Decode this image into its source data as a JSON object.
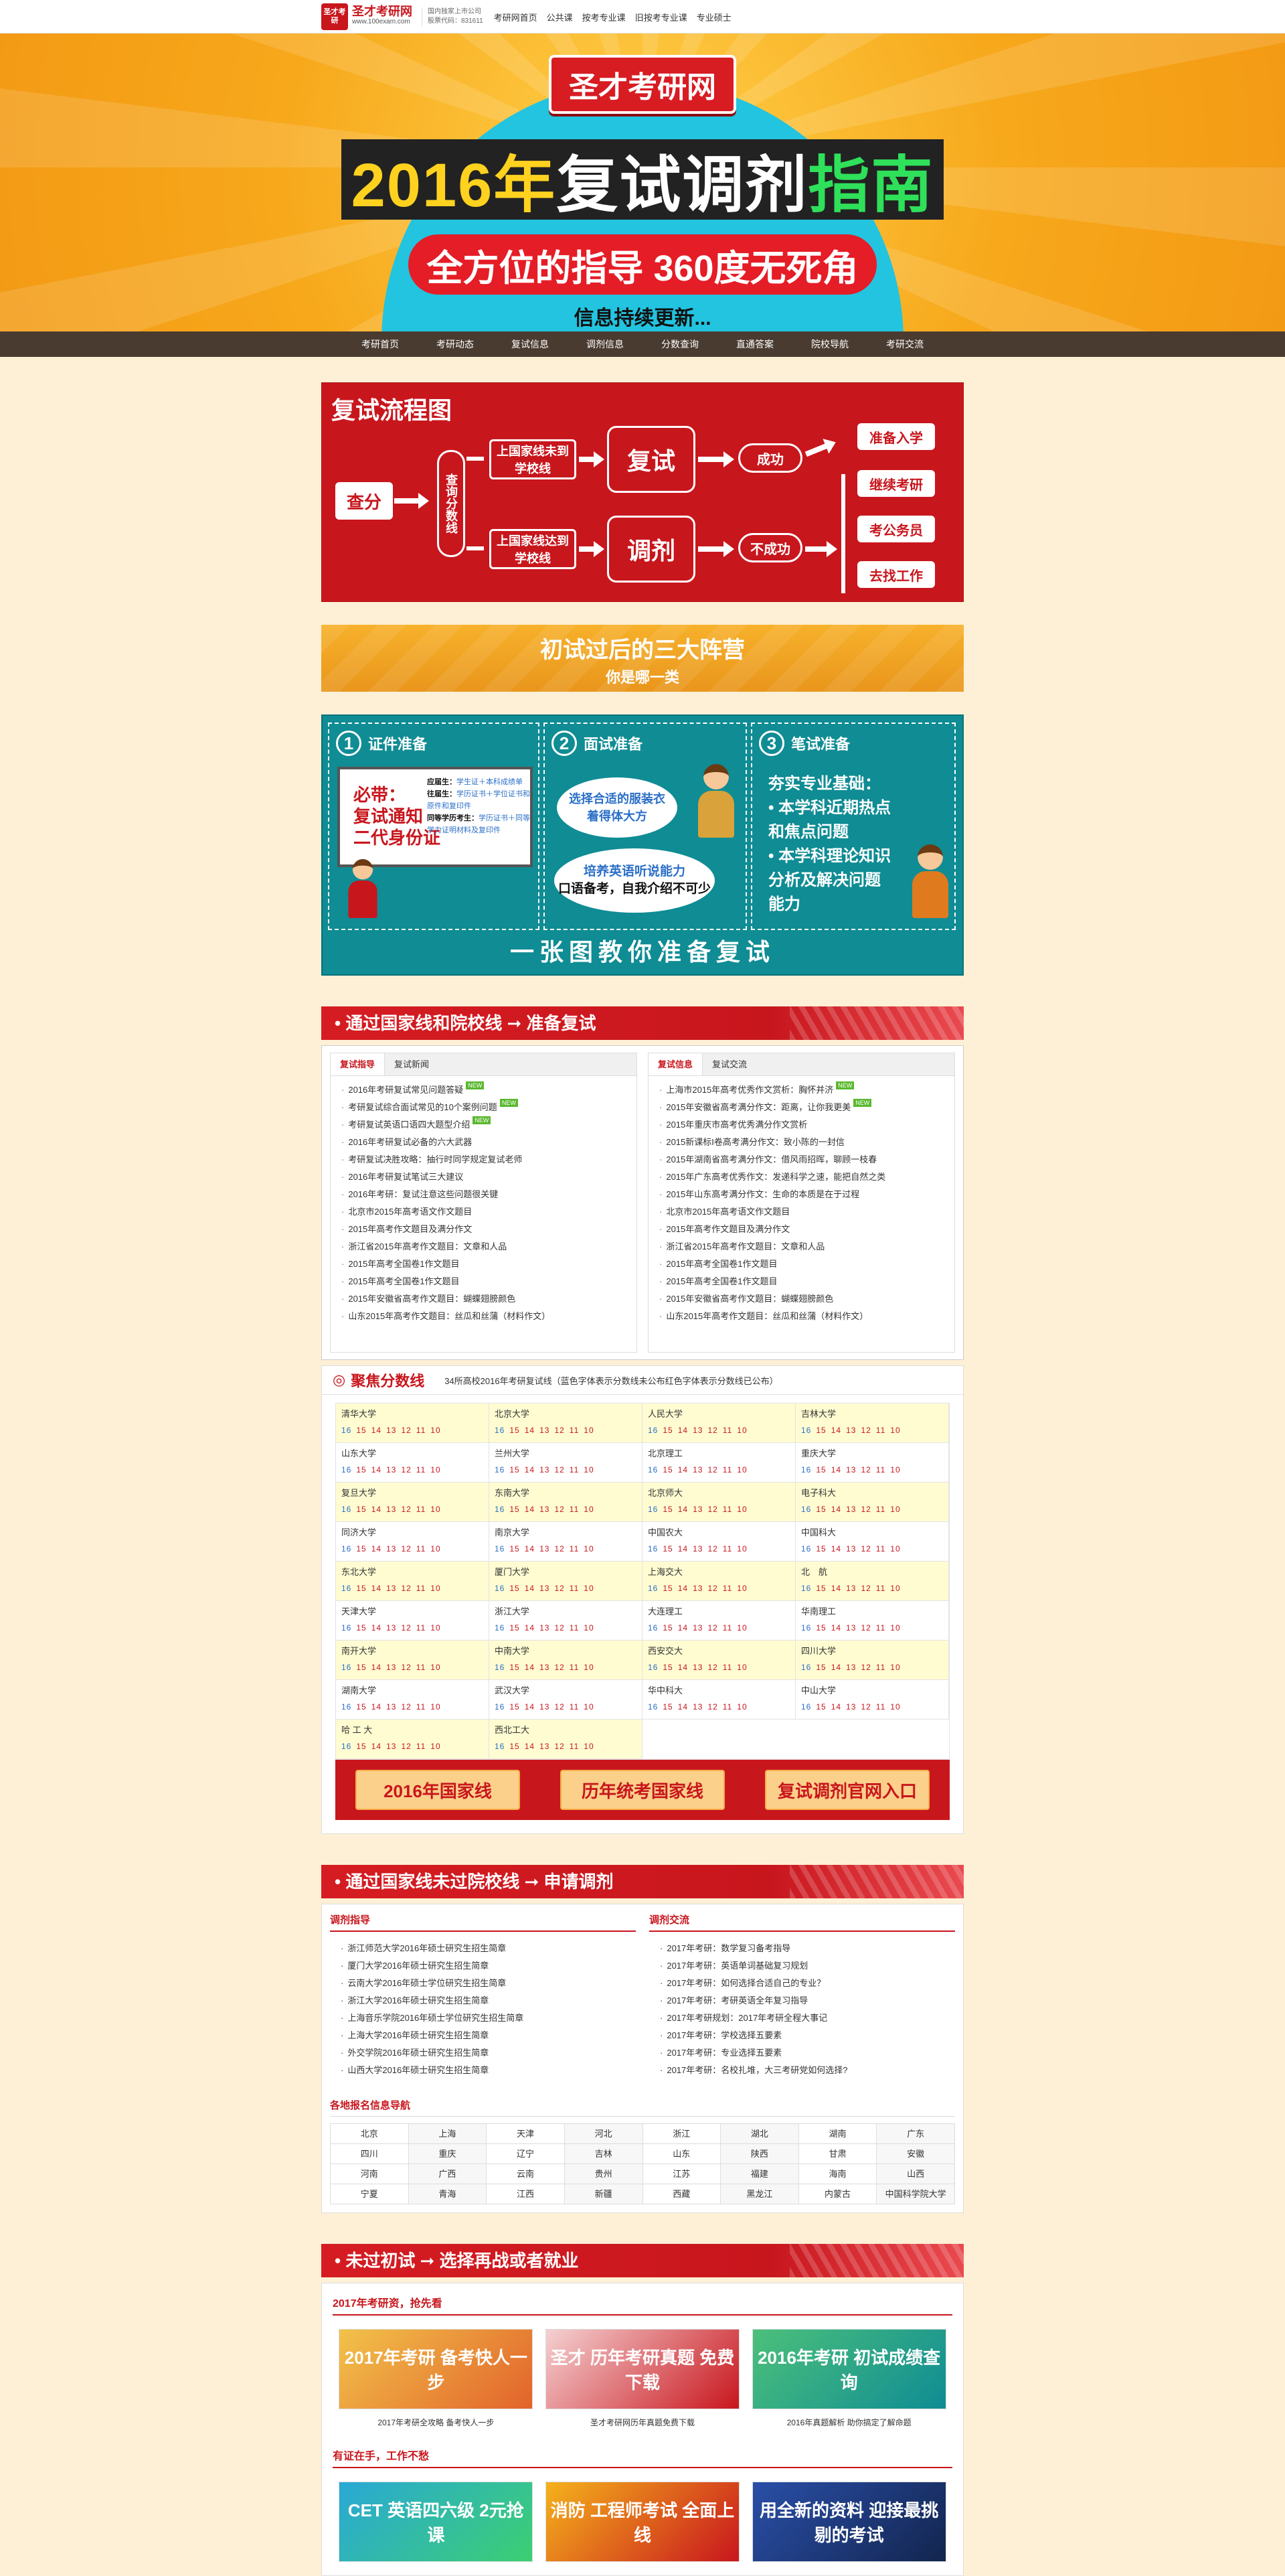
{
  "topbar": {
    "logo_mark": "圣才考研",
    "site_name": "圣才考研网",
    "site_url": "www.100exam.com",
    "company_line1": "国内独家上市公司",
    "company_line2": "股票代码：831611",
    "nav": [
      "考研网首页",
      "公共课",
      "按考专业课",
      "旧按考专业课",
      "专业硕士"
    ]
  },
  "banner": {
    "logo": "圣才考研网",
    "title_year": "2016年",
    "title_mid": "复试调剂",
    "title_end": "指南",
    "subtitle": "全方位的指导 360度无死角",
    "more": "信息持续更新..."
  },
  "mainnav": [
    "考研首页",
    "考研动态",
    "复试信息",
    "调剂信息",
    "分数查询",
    "直通答案",
    "院校导航",
    "考研交流"
  ],
  "flow": {
    "title": "复试流程图",
    "check": "查分",
    "query": "查询分数线",
    "over_nat": "上国家线未到学校线",
    "over_school": "上国家线达到学校线",
    "retest": "复试",
    "adjust": "调剂",
    "success": "成功",
    "fail": "不成功",
    "outcomes": [
      "准备入学",
      "继续考研",
      "考公务员",
      "去找工作"
    ]
  },
  "camp": {
    "title": "初试过后的三大阵营",
    "sub": "你是哪一类"
  },
  "prep": {
    "c1": {
      "num": "1",
      "title": "证件准备",
      "must": [
        "必带：",
        "复试通知",
        "二代身份证"
      ],
      "items": [
        {
          "k": "应届生：",
          "v": "学生证＋本科成绩单"
        },
        {
          "k": "往届生：",
          "v": "学历证书＋学位证书和原件和复印件"
        },
        {
          "k": "同等学历考生：",
          "v": "学历证书＋同等学力证明材料及复印件"
        }
      ]
    },
    "c2": {
      "num": "2",
      "title": "面试准备",
      "b1": "选择合适的服装衣着得体大方",
      "b2a": "培养英语听说能力",
      "b2b": "口语备考，自我介绍不可少"
    },
    "c3": {
      "num": "3",
      "title": "笔试准备",
      "lines": [
        "夯实专业基础：",
        "• 本学科近期热点",
        "和焦点问题",
        "• 本学科理论知识",
        "分析及解决问题",
        "能力"
      ]
    },
    "footer": "一张图教你准备复试"
  },
  "sec1": {
    "title": "• 通过国家线和院校线 ➞ 准备复试"
  },
  "news_left": {
    "tabs": [
      "复试指导",
      "复试新闻"
    ],
    "items": [
      "2016年考研复试常见问题答疑",
      "考研复试综合面试常见的10个案例问题",
      "考研复试英语口语四大题型介绍",
      "2016年考研复试必备的六大武器",
      "考研复试决胜攻略：抽行时同学规定复试老师",
      "2016年考研复试笔试三大建议",
      "2016年考研：复试注意这些问题很关键",
      "北京市2015年高考语文作文题目",
      "2015年高考作文题目及满分作文",
      "浙江省2015年高考作文题目：文章和人品",
      "2015年高考全国卷1作文题目",
      "2015年高考全国卷1作文题目",
      "2015年安徽省高考作文题目：蝴蝶翅膀颜色",
      "山东2015年高考作文题目：丝瓜和丝蒲（材料作文）"
    ],
    "new_flags": [
      true,
      true,
      true,
      false,
      false,
      false,
      false,
      false,
      false,
      false,
      false,
      false,
      false,
      false
    ]
  },
  "news_right": {
    "tabs": [
      "复试信息",
      "复试交流"
    ],
    "items": [
      "上海市2015年高考优秀作文赏析：胸怀并济",
      "2015年安徽省高考满分作文：距离，让你我更美",
      "2015年重庆市高考优秀满分作文赏析",
      "2015新课标I卷高考满分作文：致小陈的一封信",
      "2015年湖南省高考满分作文：借风雨招晖，聊顾一枝春",
      "2015年广东高考优秀作文：发递科学之速，能把自然之类",
      "2015年山东高考满分作文：生命的本质是在于过程",
      "北京市2015年高考语文作文题目",
      "2015年高考作文题目及满分作文",
      "浙江省2015年高考作文题目：文章和人品",
      "2015年高考全国卷1作文题目",
      "2015年高考全国卷1作文题目",
      "2015年安徽省高考作文题目：蝴蝶翅膀颜色",
      "山东2015年高考作文题目：丝瓜和丝蒲（材料作文）"
    ],
    "new_flags": [
      true,
      true,
      false,
      false,
      false,
      false,
      false,
      false,
      false,
      false,
      false,
      false,
      false,
      false
    ]
  },
  "score": {
    "title": "聚焦分数线",
    "note": "34所高校2016年考研复试线（蓝色字体表示分数线未公布红色字体表示分数线已公布）",
    "years": [
      "16",
      "15",
      "14",
      "13",
      "12",
      "11",
      "10"
    ],
    "schools": [
      "清华大学",
      "北京大学",
      "人民大学",
      "吉林大学",
      "山东大学",
      "兰州大学",
      "北京理工",
      "重庆大学",
      "复旦大学",
      "东南大学",
      "北京师大",
      "电子科大",
      "同济大学",
      "南京大学",
      "中国农大",
      "中国科大",
      "东北大学",
      "厦门大学",
      "上海交大",
      "北　航",
      "天津大学",
      "浙江大学",
      "大连理工",
      "华南理工",
      "南开大学",
      "中南大学",
      "西安交大",
      "四川大学",
      "湖南大学",
      "武汉大学",
      "华中科大",
      "中山大学",
      "哈 工 大",
      "西北工大"
    ],
    "buttons": [
      "2016年国家线",
      "历年统考国家线",
      "复试调剂官网入口"
    ]
  },
  "sec2": {
    "title": "• 通过国家线未过院校线 ➞ 申请调剂"
  },
  "adjust": {
    "left_title": "调剂指导",
    "left": [
      "浙江师范大学2016年硕士研究生招生简章",
      "厦门大学2016年硕士研究生招生简章",
      "云南大学2016年硕士学位研究生招生简章",
      "浙江大学2016年硕士研究生招生简章",
      "上海音乐学院2016年硕士学位研究生招生简章",
      "上海大学2016年硕士研究生招生简章",
      "外交学院2016年硕士研究生招生简章",
      "山西大学2016年硕士研究生招生简章"
    ],
    "right_title": "调剂交流",
    "right": [
      "2017年考研：数学复习备考指导",
      "2017年考研：英语单词基础复习规划",
      "2017年考研：如何选择合适自己的专业？",
      "2017年考研：考研英语全年复习指导",
      "2017年考研规划：2017年考研全程大事记",
      "2017年考研：学校选择五要素",
      "2017年考研：专业选择五要素",
      "2017年考研：名校扎堆，大三考研党如何选择?"
    ],
    "region_title": "各地报名信息导航",
    "regions": [
      "北京",
      "上海",
      "天津",
      "河北",
      "浙江",
      "湖北",
      "湖南",
      "广东",
      "四川",
      "重庆",
      "辽宁",
      "吉林",
      "山东",
      "陕西",
      "甘肃",
      "安徽",
      "河南",
      "广西",
      "云南",
      "贵州",
      "江苏",
      "福建",
      "海南",
      "山西",
      "宁夏",
      "青海",
      "江西",
      "新疆",
      "西藏",
      "黑龙江",
      "内蒙古",
      "中国科学院大学"
    ]
  },
  "sec3": {
    "title": "• 未过初试 ➞ 选择再战或者就业"
  },
  "last": {
    "h1": "2017年考研资，抢先看",
    "promos": [
      {
        "img": "2017年考研 备考快人一步",
        "cap": "2017年考研全攻略 备考快人一步"
      },
      {
        "img": "圣才 历年考研真题 免费下载",
        "cap": "圣才考研网历年真题免费下载"
      },
      {
        "img": "2016年考研 初试成绩查询",
        "cap": "2016年真题解析 助你搞定了解命题"
      }
    ],
    "h2": "有证在手，工作不愁",
    "promos2": [
      {
        "img": "CET 英语四六级 2元抢课"
      },
      {
        "img": "消防 工程师考试 全面上线"
      },
      {
        "img": "用全新的资料 迎接最挑剔的考试"
      }
    ]
  },
  "colors": {
    "red": "#c8161d",
    "teal": "#0f8c94",
    "orange": "#f39a14",
    "blue": "#22c4e0",
    "dark": "#4a3b30"
  }
}
